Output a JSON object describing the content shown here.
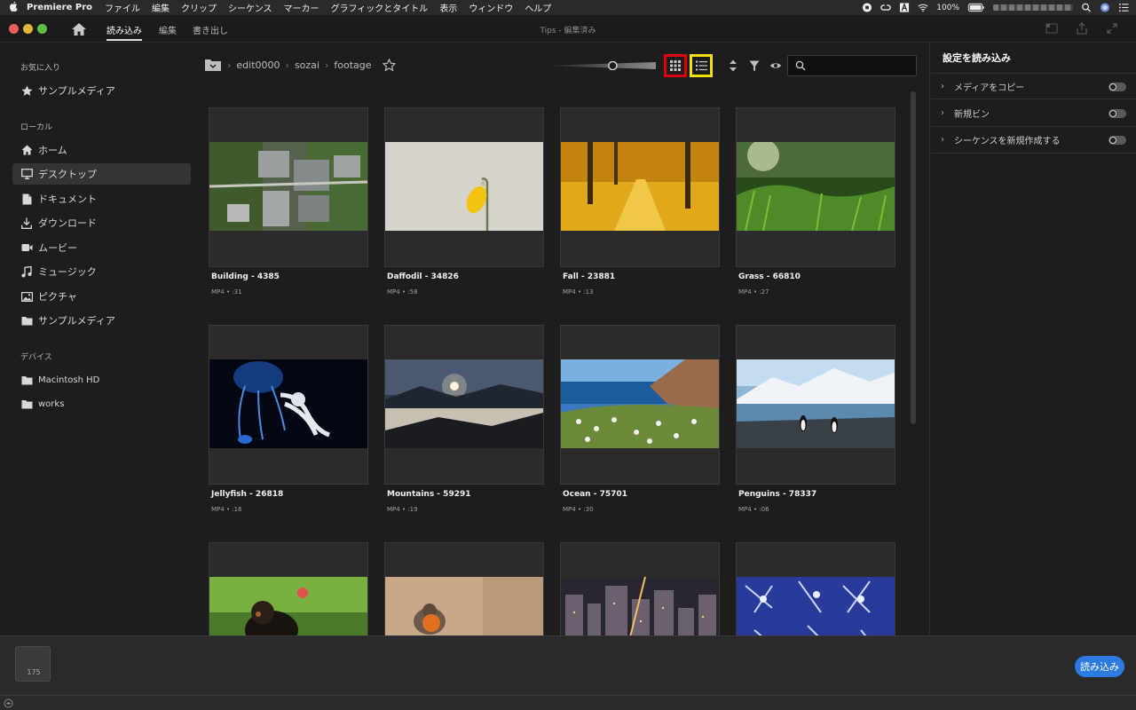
{
  "menubar": {
    "app_name": "Premiere Pro",
    "items": [
      "ファイル",
      "編集",
      "クリップ",
      "シーケンス",
      "マーカー",
      "グラフィックとタイトル",
      "表示",
      "ウィンドウ",
      "ヘルプ"
    ],
    "battery": "100%",
    "status_icons": [
      "record-icon",
      "creative-cloud-icon",
      "adobe-icon",
      "wifi-icon",
      "battery-icon",
      "search-icon",
      "siri-icon",
      "control-center-icon"
    ]
  },
  "titlebar": {
    "tabs": [
      "読み込み",
      "編集",
      "書き出し"
    ],
    "active_tab": "読み込み",
    "title": "Tips - 編集済み"
  },
  "sidebar": {
    "favorites_title": "お気に入り",
    "favorites": [
      {
        "label": "サンプルメディア",
        "icon": "star-icon"
      }
    ],
    "local_title": "ローカル",
    "local": [
      {
        "label": "ホーム",
        "icon": "home-icon"
      },
      {
        "label": "デスクトップ",
        "icon": "desktop-icon",
        "selected": true
      },
      {
        "label": "ドキュメント",
        "icon": "document-icon"
      },
      {
        "label": "ダウンロード",
        "icon": "download-icon"
      },
      {
        "label": "ムービー",
        "icon": "movie-icon"
      },
      {
        "label": "ミュージック",
        "icon": "music-icon"
      },
      {
        "label": "ピクチャ",
        "icon": "picture-icon"
      },
      {
        "label": "サンプルメディア",
        "icon": "folder-icon"
      }
    ],
    "devices_title": "デバイス",
    "devices": [
      {
        "label": "Macintosh HD",
        "icon": "folder-icon"
      },
      {
        "label": "works",
        "icon": "folder-icon"
      }
    ]
  },
  "browser": {
    "breadcrumb": [
      "edit0000",
      "sozai",
      "footage"
    ],
    "search_placeholder": "",
    "view_mode": "grid",
    "zoom_level": 0.62,
    "items": [
      {
        "name": "Building - 4385",
        "meta": "MP4 • :31",
        "scene": "building"
      },
      {
        "name": "Daffodil - 34826",
        "meta": "MP4 • :58",
        "scene": "daffodil"
      },
      {
        "name": "Fall - 23881",
        "meta": "MP4 • :13",
        "scene": "fall"
      },
      {
        "name": "Grass - 66810",
        "meta": "MP4 • :27",
        "scene": "grass"
      },
      {
        "name": "Jellyfish - 26818",
        "meta": "MP4 • :16",
        "scene": "jellyfish"
      },
      {
        "name": "Mountains - 59291",
        "meta": "MP4 • :19",
        "scene": "mountains"
      },
      {
        "name": "Ocean - 75701",
        "meta": "MP4 • :30",
        "scene": "ocean"
      },
      {
        "name": "Penguins - 78337",
        "meta": "MP4 • :06",
        "scene": "penguins"
      },
      {
        "name": "",
        "meta": "",
        "scene": "puppy"
      },
      {
        "name": "",
        "meta": "",
        "scene": "robin"
      },
      {
        "name": "",
        "meta": "",
        "scene": "city"
      },
      {
        "name": "",
        "meta": "",
        "scene": "snow"
      }
    ]
  },
  "settings": {
    "title": "設定を読み込み",
    "rows": [
      {
        "label": "メディアをコピー",
        "on": false
      },
      {
        "label": "新規ビン",
        "on": false
      },
      {
        "label": "シーケンスを新規作成する",
        "on": false
      }
    ]
  },
  "tray": {
    "count": "175",
    "import_label": "読み込み"
  },
  "colors": {
    "accent": "#2d7ae0",
    "highlight_grid": "#e0000f",
    "highlight_list": "#f5e100"
  }
}
